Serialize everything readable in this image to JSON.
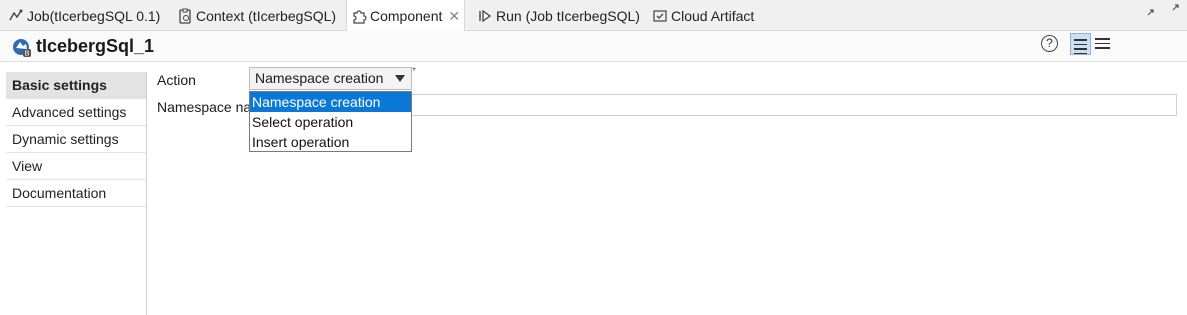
{
  "tabs": [
    {
      "label": "Job(tIcerbegSQL 0.1)",
      "icon": "job-icon"
    },
    {
      "label": "Context (tIcerbegSQL)",
      "icon": "context-icon"
    },
    {
      "label": "Component",
      "icon": "puzzle-icon",
      "active": true
    },
    {
      "label": "Run (Job tIcerbegSQL)",
      "icon": "run-icon"
    },
    {
      "label": "Cloud Artifact",
      "icon": "cloud-artifact-icon"
    }
  ],
  "header": {
    "title": "tIcebergSql_1",
    "help": "?"
  },
  "nav": {
    "items": [
      {
        "label": "Basic settings",
        "selected": true
      },
      {
        "label": "Advanced settings"
      },
      {
        "label": "Dynamic settings"
      },
      {
        "label": "View"
      },
      {
        "label": "Documentation"
      }
    ]
  },
  "form": {
    "action_label": "Action",
    "action_value": "Namespace creation",
    "required_mark": "*",
    "namespace_label": "Namespace na",
    "dropdown_options": [
      "Namespace creation",
      "Select operation",
      "Insert operation"
    ],
    "highlighted_option": "Namespace creation"
  },
  "colors": {
    "accent": "#0a78d7",
    "selected_nav": "#e3e3e3",
    "view_btn_active": "#cce0f5"
  }
}
